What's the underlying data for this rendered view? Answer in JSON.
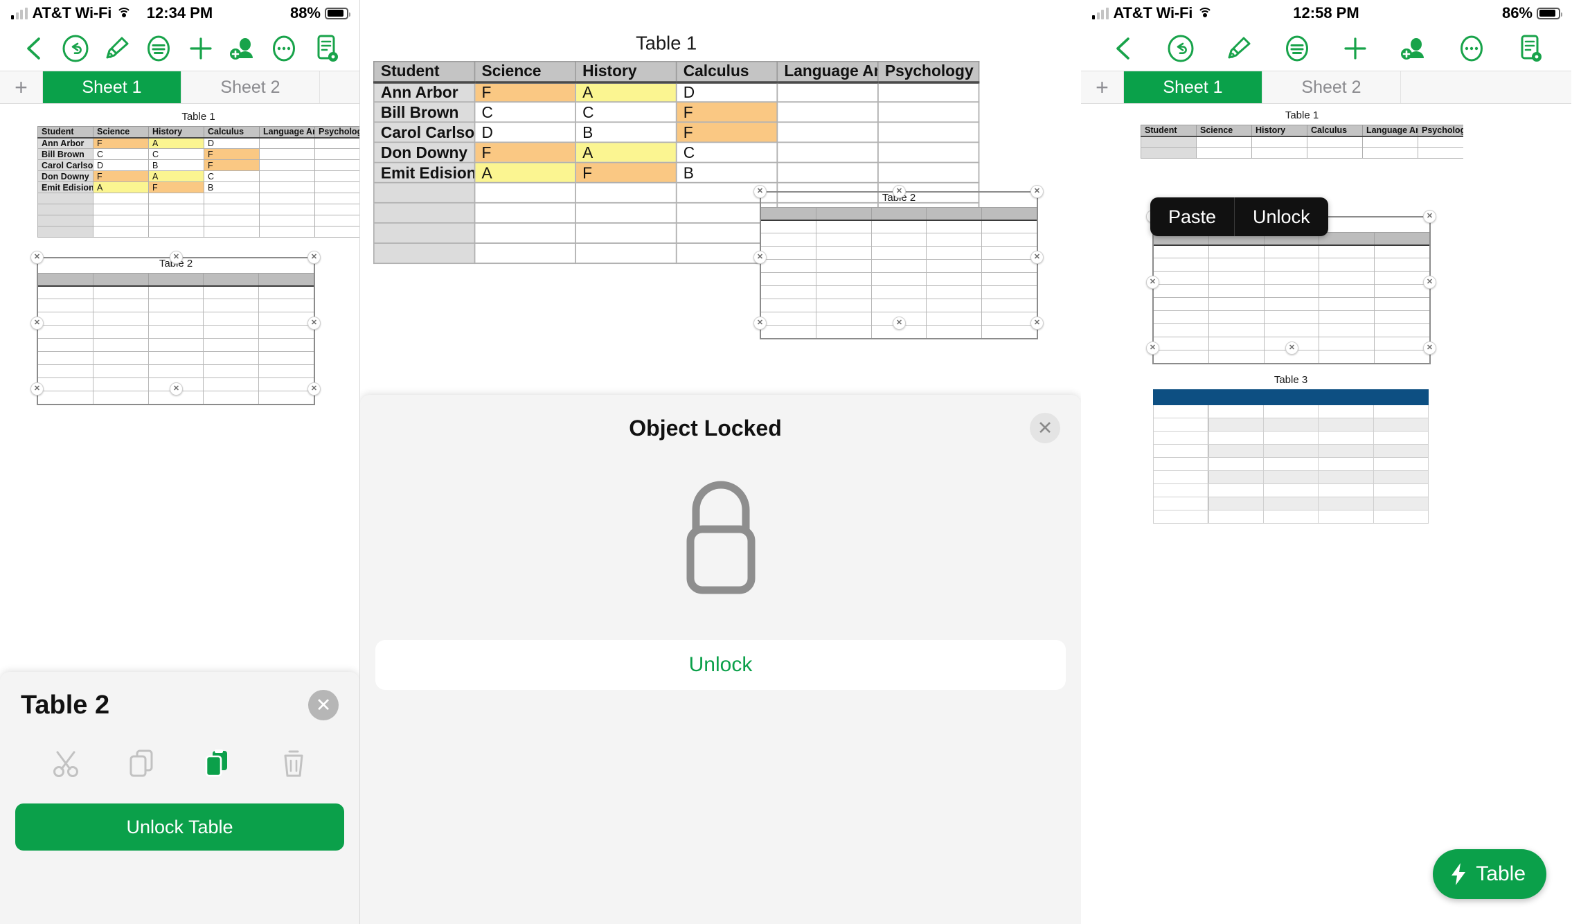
{
  "panels": {
    "left": {
      "status": {
        "carrier": "AT&T Wi-Fi",
        "time": "12:34 PM",
        "battery": "88%"
      },
      "tabs": {
        "add": "+",
        "sheet1": "Sheet 1",
        "sheet2": "Sheet 2"
      },
      "sheet": {
        "title": "Table 2",
        "close": "✕",
        "primary_button": "Unlock Table",
        "actions": [
          "cut-icon",
          "copy-icon",
          "paste-icon",
          "delete-icon"
        ]
      }
    },
    "mid": {
      "sheet": {
        "title": "Object Locked",
        "close": "✕",
        "icon": "lock-icon",
        "primary_button": "Unlock"
      }
    },
    "right": {
      "status": {
        "carrier": "AT&T Wi-Fi",
        "time": "12:58 PM",
        "battery": "86%"
      },
      "tabs": {
        "add": "+",
        "sheet1": "Sheet 1",
        "sheet2": "Sheet 2"
      },
      "context_menu": {
        "paste": "Paste",
        "unlock": "Unlock"
      },
      "fab": {
        "label": "Table",
        "icon": "bolt-icon"
      }
    }
  },
  "toolbar": {
    "items": [
      {
        "name": "back-icon",
        "label": "Back"
      },
      {
        "name": "undo-icon",
        "label": "Undo"
      },
      {
        "name": "brush-icon",
        "label": "Format"
      },
      {
        "name": "insert-icon",
        "label": "Insert"
      },
      {
        "name": "plus-icon",
        "label": "Add"
      },
      {
        "name": "add-person-icon",
        "label": "Collaborate"
      },
      {
        "name": "more-icon",
        "label": "More"
      },
      {
        "name": "document-icon",
        "label": "Document"
      }
    ]
  },
  "tables": {
    "table1": {
      "title": "Table 1",
      "columns": [
        "Student",
        "Science",
        "History",
        "Calculus",
        "Language Arts",
        "Psychology"
      ],
      "rows": [
        {
          "student": "Ann Arbor",
          "cells": [
            {
              "v": "F",
              "hl": "orange"
            },
            {
              "v": "A",
              "hl": "yellow"
            },
            {
              "v": "D",
              "hl": ""
            },
            {
              "v": "",
              "hl": ""
            },
            {
              "v": "",
              "hl": ""
            }
          ]
        },
        {
          "student": "Bill Brown",
          "cells": [
            {
              "v": "C",
              "hl": ""
            },
            {
              "v": "C",
              "hl": ""
            },
            {
              "v": "F",
              "hl": "orange"
            },
            {
              "v": "",
              "hl": ""
            },
            {
              "v": "",
              "hl": ""
            }
          ]
        },
        {
          "student": "Carol Carlson",
          "cells": [
            {
              "v": "D",
              "hl": ""
            },
            {
              "v": "B",
              "hl": ""
            },
            {
              "v": "F",
              "hl": "orange"
            },
            {
              "v": "",
              "hl": ""
            },
            {
              "v": "",
              "hl": ""
            }
          ]
        },
        {
          "student": "Don Downy",
          "cells": [
            {
              "v": "F",
              "hl": "orange"
            },
            {
              "v": "A",
              "hl": "yellow"
            },
            {
              "v": "C",
              "hl": ""
            },
            {
              "v": "",
              "hl": ""
            },
            {
              "v": "",
              "hl": ""
            }
          ]
        },
        {
          "student": "Emit Edision",
          "cells": [
            {
              "v": "A",
              "hl": "yellow"
            },
            {
              "v": "F",
              "hl": "orange"
            },
            {
              "v": "B",
              "hl": ""
            },
            {
              "v": "",
              "hl": ""
            },
            {
              "v": "",
              "hl": ""
            }
          ]
        }
      ],
      "empty_rows": 4
    },
    "table2": {
      "title": "Table 2",
      "columns": 5,
      "body_rows": 9,
      "header_style": "gray"
    },
    "table3": {
      "title": "Table 3",
      "columns": 5,
      "body_rows": 9,
      "header_style": "blue",
      "header_color": "#0d4f82"
    }
  },
  "colors": {
    "accent_green": "#0aa14a",
    "highlight_orange": "#fac883",
    "highlight_yellow": "#fbf591",
    "table_header_gray": "#c4c4c4",
    "table3_header_blue": "#0d4f82"
  }
}
